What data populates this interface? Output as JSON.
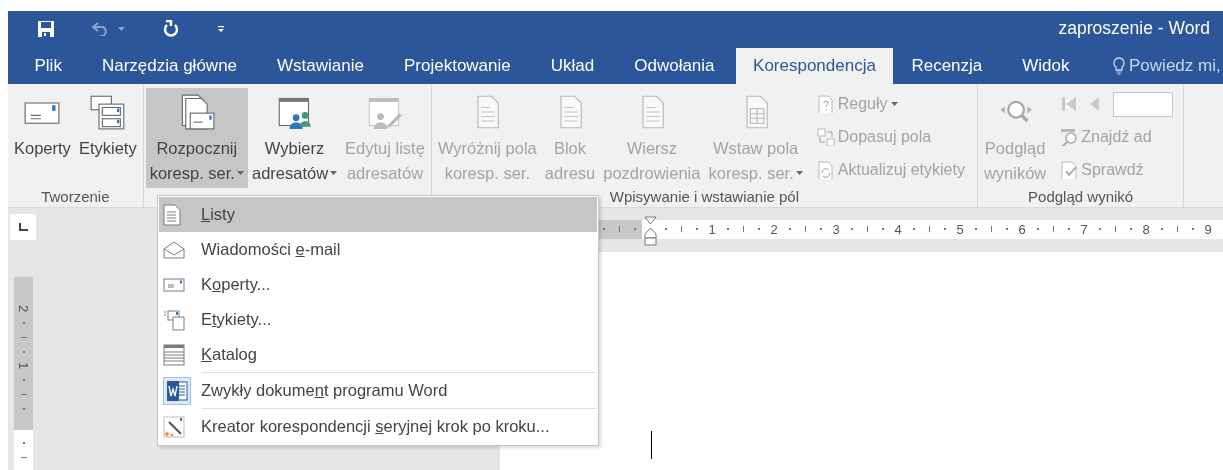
{
  "title_bar": {
    "title": "zaproszenie - Word",
    "quick_access": [
      {
        "kind": "save",
        "disabled": false
      },
      {
        "kind": "undo",
        "disabled": true
      },
      {
        "kind": "repeat",
        "disabled": false
      },
      {
        "kind": "customize",
        "disabled": false
      }
    ]
  },
  "tabs": [
    {
      "label": "Plik",
      "selected": false
    },
    {
      "label": "Narzędzia główne",
      "selected": false
    },
    {
      "label": "Wstawianie",
      "selected": false
    },
    {
      "label": "Projektowanie",
      "selected": false
    },
    {
      "label": "Układ",
      "selected": false
    },
    {
      "label": "Odwołania",
      "selected": false
    },
    {
      "label": "Korespondencja",
      "selected": true
    },
    {
      "label": "Recenzja",
      "selected": false
    },
    {
      "label": "Widok",
      "selected": false
    }
  ],
  "tell_me": {
    "placeholder": "Powiedz mi,"
  },
  "ribbon": {
    "groups": [
      {
        "label": "Tworzenie",
        "items": [
          {
            "kind": "large",
            "lines": [
              "Koperty"
            ],
            "disabled": false,
            "pressed": false,
            "dropdown": false
          },
          {
            "kind": "large",
            "lines": [
              "Etykiety"
            ],
            "disabled": false,
            "pressed": false,
            "dropdown": false
          }
        ]
      },
      {
        "items": [
          {
            "kind": "large",
            "lines": [
              "Rozpocznij",
              "koresp. ser."
            ],
            "disabled": false,
            "pressed": true,
            "dropdown": true
          },
          {
            "kind": "large",
            "lines": [
              "Wybierz",
              "adresatów"
            ],
            "disabled": false,
            "pressed": false,
            "dropdown": true
          },
          {
            "kind": "large",
            "lines": [
              "Edytuj listę",
              "adresatów"
            ],
            "disabled": true,
            "pressed": false,
            "dropdown": false
          }
        ]
      },
      {
        "label": "Wpisywanie i wstawianie pól",
        "items": [
          {
            "kind": "large",
            "lines": [
              "Wyróżnij pola",
              "koresp. ser."
            ],
            "disabled": true,
            "pressed": false,
            "dropdown": false
          },
          {
            "kind": "large",
            "lines": [
              "Blok",
              "adresu"
            ],
            "disabled": true,
            "pressed": false,
            "dropdown": false
          },
          {
            "kind": "large",
            "lines": [
              "Wiersz",
              "pozdrowienia"
            ],
            "disabled": true,
            "pressed": false,
            "dropdown": false
          },
          {
            "kind": "large",
            "lines": [
              "Wstaw pola",
              "koresp. ser."
            ],
            "disabled": true,
            "pressed": false,
            "dropdown": true
          },
          {
            "kind": "stack",
            "children": [
              {
                "kind": "small",
                "label": "Reguły",
                "disabled": true,
                "dropdown": true
              },
              {
                "kind": "small",
                "label": "Dopasuj pola",
                "disabled": true,
                "dropdown": false
              },
              {
                "kind": "small",
                "label": "Aktualizuj etykiety",
                "disabled": true,
                "dropdown": false
              }
            ]
          }
        ]
      },
      {
        "label": "Podgląd wynikó",
        "items": [
          {
            "kind": "large",
            "lines": [
              "Podgląd",
              "wyników"
            ],
            "disabled": true,
            "pressed": false,
            "dropdown": false
          },
          {
            "kind": "stack",
            "children": [
              {
                "kind": "nav",
                "buttons": [
                  {
                    "disabled": true
                  },
                  {
                    "disabled": true
                  }
                ]
              },
              {
                "kind": "small",
                "label": "Znajdź ad",
                "disabled": true,
                "dropdown": false
              },
              {
                "kind": "small",
                "label": "Sprawdź",
                "disabled": true,
                "dropdown": false
              }
            ]
          }
        ]
      }
    ]
  },
  "menu": {
    "items": [
      {
        "kind": "letters",
        "key": "L",
        "post": "isty",
        "selected": true,
        "separator_before": false
      },
      {
        "kind": "email",
        "pre": "Wiadomości ",
        "key": "e",
        "post": "-mail",
        "selected": false,
        "separator_before": false
      },
      {
        "kind": "envelopes",
        "pre": "K",
        "key": "o",
        "post": "perty...",
        "selected": false,
        "separator_before": false
      },
      {
        "kind": "labels",
        "pre": "E",
        "key": "t",
        "post": "ykiety...",
        "selected": false,
        "separator_before": false
      },
      {
        "kind": "directory",
        "key": "K",
        "post": "atalog",
        "selected": false,
        "separator_before": false
      },
      {
        "kind": "normal_document",
        "pre": "Zwykły dokume",
        "key": "n",
        "post": "t programu Word",
        "selected": false,
        "separator_before": true
      },
      {
        "kind": "wizard",
        "pre": "Kreator korespondencji ",
        "key": "s",
        "post": "eryjnej krok po kroku...",
        "selected": false,
        "separator_before": true
      }
    ]
  },
  "horizontal_ruler": {
    "numbers": [
      "1",
      "2",
      "3",
      "4",
      "5",
      "6",
      "7",
      "8",
      "9"
    ]
  },
  "vertical_ruler": {
    "numbers": [
      "2",
      "1"
    ]
  }
}
